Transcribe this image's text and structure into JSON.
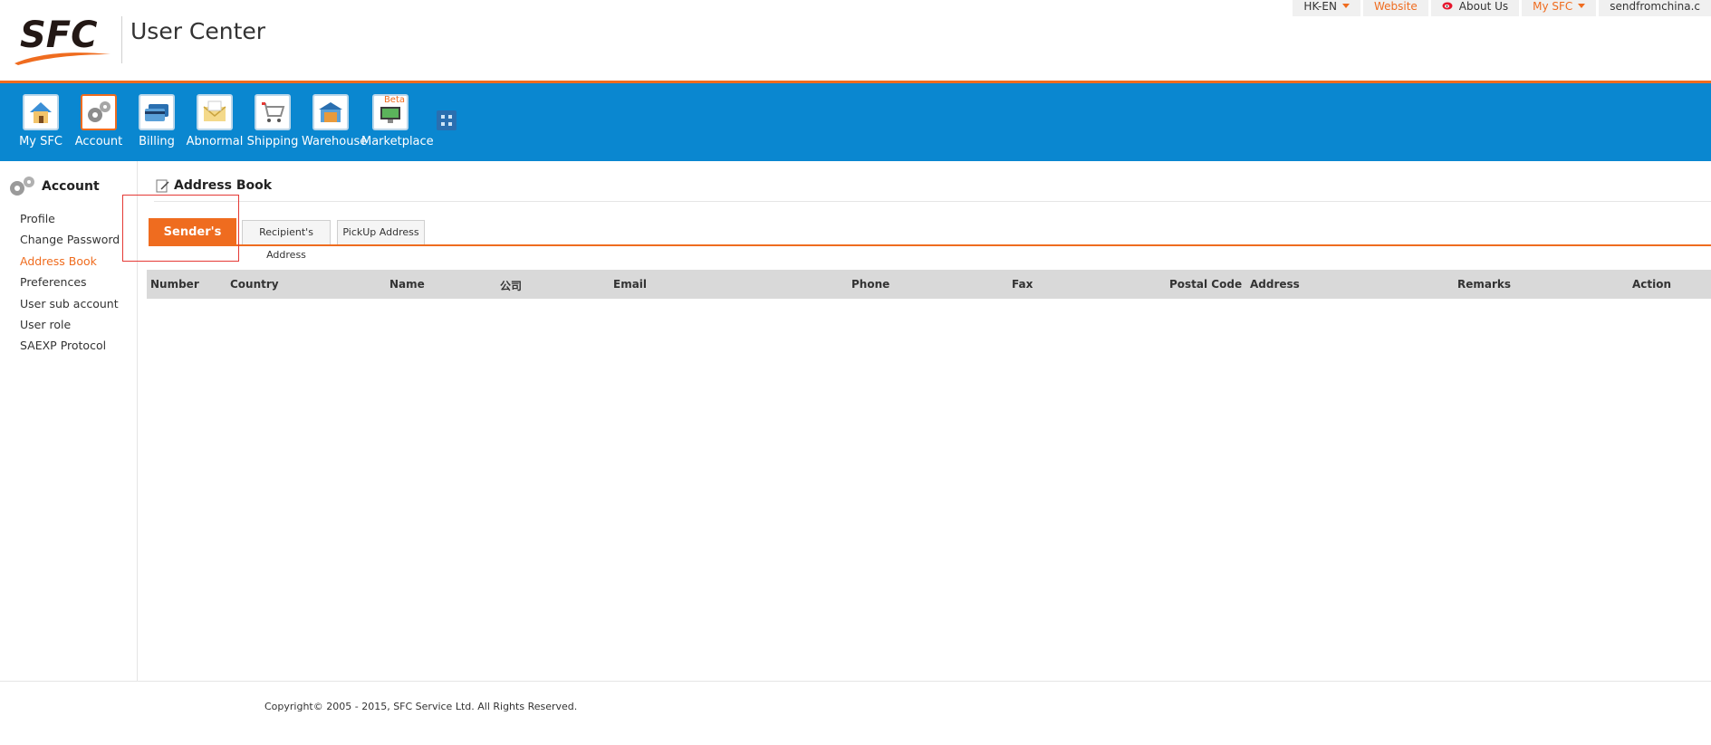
{
  "header": {
    "logo_text": "SFC",
    "site_title": "User Center",
    "top_links": [
      {
        "label": "HK-EN",
        "has_caret": true
      },
      {
        "label": "Website"
      },
      {
        "label": "About Us"
      },
      {
        "label": "My SFC",
        "has_caret": true
      },
      {
        "label": "sendfromchina.c"
      }
    ]
  },
  "nav": {
    "items": [
      {
        "label": "My SFC",
        "icon": "home-icon"
      },
      {
        "label": "Account",
        "icon": "gear-icon"
      },
      {
        "label": "Billing",
        "icon": "credit-card-icon"
      },
      {
        "label": "Abnormal",
        "icon": "envelope-icon"
      },
      {
        "label": "Shipping",
        "icon": "cart-icon"
      },
      {
        "label": "Warehouse",
        "icon": "warehouse-icon"
      },
      {
        "label": "Marketplace",
        "icon": "monitor-icon",
        "badge": "Beta"
      }
    ],
    "more_icon": "grid-icon"
  },
  "sidebar": {
    "title": "Account",
    "items": [
      {
        "label": "Profile"
      },
      {
        "label": "Change Password"
      },
      {
        "label": "Address Book",
        "active": true
      },
      {
        "label": "Preferences"
      },
      {
        "label": "User sub account"
      },
      {
        "label": "User role"
      },
      {
        "label": "SAEXP Protocol"
      }
    ]
  },
  "main": {
    "title": "Address Book",
    "tabs": [
      {
        "label": "Sender's",
        "active": true
      },
      {
        "label": "Recipient's Address"
      },
      {
        "label": "PickUp Address"
      }
    ],
    "table_headers": [
      "Number",
      "Country",
      "Name",
      "公司",
      "Email",
      "Phone",
      "Fax",
      "Postal Code",
      "Address",
      "Remarks",
      "Action"
    ]
  },
  "footer": {
    "copyright": "Copyright© 2005 - 2015, SFC Service Ltd. All Rights Reserved."
  },
  "colors": {
    "accent": "#ef6c1f",
    "nav_bg": "#0a87d0",
    "table_header_bg": "#d9d9d9",
    "highlight": "#e53935"
  }
}
